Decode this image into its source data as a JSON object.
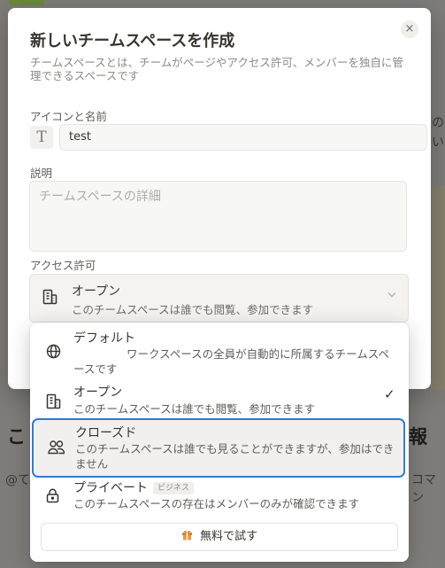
{
  "background": {
    "heading_fragment_left": "こ",
    "heading_fragment_right": "報",
    "mention_fragment_left": "@て",
    "mention_fragment_right": "コマン",
    "side_text_1": "の",
    "side_text_2": "い"
  },
  "modal": {
    "title": "新しいチームスペースを作成",
    "description": "チームスペースとは、チームがページやアクセス許可、メンバーを独自に管理できるスペースです",
    "close_icon_glyph": "×",
    "icon_and_name_label": "アイコンと名前",
    "icon_letter": "T",
    "name_value": "test",
    "description_label": "説明",
    "description_placeholder": "チームスペースの詳細",
    "access_label": "アクセス許可",
    "selected_access": {
      "title": "オープン",
      "description": "このチームスペースは誰でも閲覧、参加できます",
      "icon": "building-icon"
    }
  },
  "dropdown": {
    "options": [
      {
        "title": "デフォルト",
        "description": "ワークスペースの全員が自動的に所属するチームスペースです",
        "icon": "globe-icon"
      },
      {
        "title": "オープン",
        "description": "このチームスペースは誰でも閲覧、参加できます",
        "icon": "building-icon",
        "checked": true
      },
      {
        "title": "クローズド",
        "description": "このチームスペースは誰でも見ることができますが、参加はできません",
        "icon": "people-icon",
        "highlighted": true
      },
      {
        "title": "プライベート",
        "badge": "ビジネス",
        "description": "このチームスペースの存在はメンバーのみが確認できます",
        "icon": "lock-icon"
      }
    ],
    "check_glyph": "✓",
    "trial_button_label": "無料で試す"
  },
  "colors": {
    "overlay": "#7d7c79",
    "focus_ring": "#2f7bd6",
    "gift_icon": "#d9822b"
  }
}
